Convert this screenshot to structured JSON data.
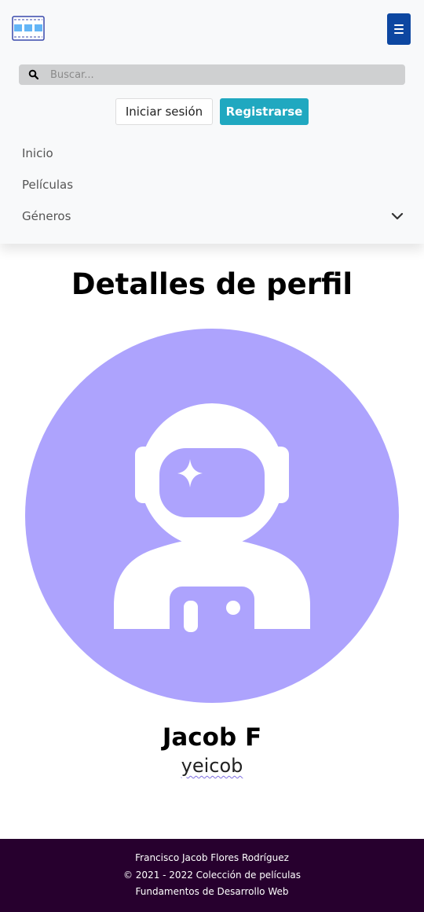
{
  "navbar": {
    "brand_icon": "film-strip-icon",
    "toggler_icon": "hamburger-menu-icon",
    "search": {
      "placeholder": "Buscar...",
      "icon": "search-icon"
    },
    "buttons": {
      "login": "Iniciar sesión",
      "register": "Registrarse"
    },
    "items": [
      {
        "label": "Inicio"
      },
      {
        "label": "Películas"
      },
      {
        "label": "Géneros",
        "icon": "chevron-down-icon"
      }
    ],
    "colors": {
      "toggler": "#0d47a1",
      "register": "#20a8c0"
    }
  },
  "main": {
    "title": "Detalles de perfil",
    "avatar": {
      "icon": "astronaut-avatar-icon",
      "color": "#ada3fd"
    },
    "full_name": "Jacob F",
    "username": "yeicob"
  },
  "footer": {
    "author": "Francisco Jacob Flores Rodríguez",
    "copyright": "© 2021 - 2022 Colección de películas",
    "course": "Fundamentos de Desarrollo Web",
    "color": "#27002e"
  }
}
